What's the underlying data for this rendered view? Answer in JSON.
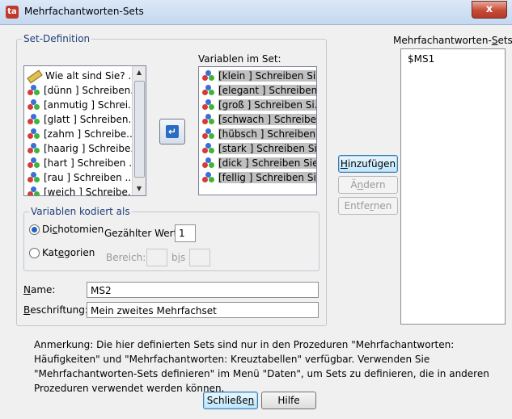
{
  "window": {
    "title": "Mehrfachantworten-Sets",
    "close_symbol": "x"
  },
  "set_definition": {
    "legend": "Set-Definition",
    "source_items": [
      {
        "label": "Wie alt sind Sie? ...",
        "icon": "ruler-icon"
      },
      {
        "label": "[dünn ] Schreiben...",
        "icon": "variable-icon"
      },
      {
        "label": "[anmutig ] Schrei...",
        "icon": "variable-icon"
      },
      {
        "label": "[glatt ] Schreiben...",
        "icon": "variable-icon"
      },
      {
        "label": "[zahm ] Schreibe...",
        "icon": "variable-icon"
      },
      {
        "label": "[haarig ] Schreibe...",
        "icon": "variable-icon"
      },
      {
        "label": "[hart ] Schreiben ...",
        "icon": "variable-icon"
      },
      {
        "label": "[rau ] Schreiben ...",
        "icon": "variable-icon"
      },
      {
        "label": "[weich ] Schreibe...",
        "icon": "variable-icon"
      }
    ],
    "variables_label": "Variablen im Set:",
    "set_items": [
      {
        "label": "[klein ] Schreiben Si..."
      },
      {
        "label": "[elegant ] Schreiben..."
      },
      {
        "label": "[groß ] Schreiben Si..."
      },
      {
        "label": "[schwach ] Schreibe..."
      },
      {
        "label": "[hübsch ] Schreiben..."
      },
      {
        "label": "[stark ] Schreiben Si..."
      },
      {
        "label": "[dick ] Schreiben Sie..."
      },
      {
        "label": "[fellig ] Schreiben Si..."
      }
    ],
    "coded_as": {
      "legend": "Variablen kodiert als",
      "dichotomies": {
        "pre": "Di",
        "u": "c",
        "post": "hotomien"
      },
      "categories": {
        "pre": "Kat",
        "u": "e",
        "post": "gorien"
      },
      "counted_value_label": "Gezählter Wert:",
      "counted_value": "1",
      "range_label": "Bereich:",
      "through_label": {
        "pre": "b",
        "u": "i",
        "post": "s"
      }
    },
    "name_label": {
      "u": "N",
      "post": "ame:"
    },
    "name_value": "MS2",
    "caption_label": {
      "u": "B",
      "post": "eschriftung:"
    },
    "caption_value": "Mein zweites Mehrfachset"
  },
  "sets_panel": {
    "label": {
      "pre": "Mehrfachantworten-",
      "u": "S",
      "post": "ets:"
    },
    "items": [
      "$MS1"
    ]
  },
  "buttons": {
    "add": {
      "u": "H",
      "post": "inzufügen"
    },
    "change": {
      "pre": "Ä",
      "u": "n",
      "post": "dern"
    },
    "remove": {
      "pre": "Entfe",
      "u": "r",
      "post": "nen"
    },
    "close": {
      "pre": "Schließe",
      "u": "n",
      "post": ""
    },
    "help": "Hilfe"
  },
  "note": "Anmerkung: Die hier definierten Sets sind nur in den Prozeduren \"Mehrfachantworten: Häufigkeiten\" und \"Mehrfachantworten: Kreuztabellen\" verfügbar. Verwenden Sie \"Mehrfachantworten-Sets definieren\" im Menü \"Daten\", um Sets zu definieren, die in anderen Prozeduren verwendet werden können.",
  "colors": {
    "accent": "#1f3f7a",
    "selection": "#c0c0c0",
    "transfer_arrow": "#2a6cc4"
  }
}
